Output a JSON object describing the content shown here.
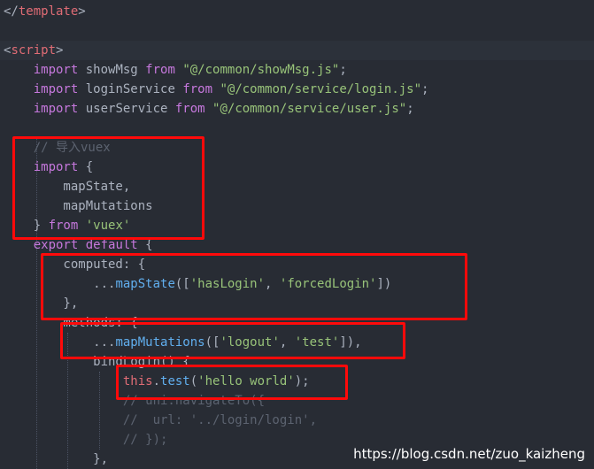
{
  "code_lines": [
    {
      "tokens": [
        {
          "t": "</",
          "c": "plain"
        },
        {
          "t": "template",
          "c": "tag"
        },
        {
          "t": ">",
          "c": "plain"
        }
      ]
    },
    {
      "tokens": []
    },
    {
      "tokens": [
        {
          "t": "<",
          "c": "plain"
        },
        {
          "t": "script",
          "c": "tag"
        },
        {
          "t": ">",
          "c": "plain"
        }
      ]
    },
    {
      "tokens": [
        {
          "t": "    "
        },
        {
          "t": "import",
          "c": "kw"
        },
        {
          "t": " showMsg ",
          "c": "plain"
        },
        {
          "t": "from",
          "c": "kw"
        },
        {
          "t": " ",
          "c": "plain"
        },
        {
          "t": "\"@/common/showMsg.js\"",
          "c": "str"
        },
        {
          "t": ";",
          "c": "plain"
        }
      ]
    },
    {
      "tokens": [
        {
          "t": "    "
        },
        {
          "t": "import",
          "c": "kw"
        },
        {
          "t": " loginService ",
          "c": "plain"
        },
        {
          "t": "from",
          "c": "kw"
        },
        {
          "t": " ",
          "c": "plain"
        },
        {
          "t": "\"@/common/service/login.js\"",
          "c": "str"
        },
        {
          "t": ";",
          "c": "plain"
        }
      ]
    },
    {
      "tokens": [
        {
          "t": "    "
        },
        {
          "t": "import",
          "c": "kw"
        },
        {
          "t": " userService ",
          "c": "plain"
        },
        {
          "t": "from",
          "c": "kw"
        },
        {
          "t": " ",
          "c": "plain"
        },
        {
          "t": "\"@/common/service/user.js\"",
          "c": "str"
        },
        {
          "t": ";",
          "c": "plain"
        }
      ]
    },
    {
      "tokens": []
    },
    {
      "tokens": [
        {
          "t": "    "
        },
        {
          "t": "// 导入vuex",
          "c": "comment"
        }
      ]
    },
    {
      "tokens": [
        {
          "t": "    "
        },
        {
          "t": "import",
          "c": "kw"
        },
        {
          "t": " {",
          "c": "plain"
        }
      ]
    },
    {
      "tokens": [
        {
          "t": "        mapState,",
          "c": "plain"
        }
      ]
    },
    {
      "tokens": [
        {
          "t": "        mapMutations",
          "c": "plain"
        }
      ]
    },
    {
      "tokens": [
        {
          "t": "    } ",
          "c": "plain"
        },
        {
          "t": "from",
          "c": "kw"
        },
        {
          "t": " ",
          "c": "plain"
        },
        {
          "t": "'vuex'",
          "c": "str"
        }
      ]
    },
    {
      "tokens": [
        {
          "t": "    "
        },
        {
          "t": "export",
          "c": "kw"
        },
        {
          "t": " ",
          "c": "plain"
        },
        {
          "t": "default",
          "c": "kw"
        },
        {
          "t": " {",
          "c": "plain"
        }
      ]
    },
    {
      "tokens": [
        {
          "t": "        computed: {",
          "c": "plain"
        }
      ]
    },
    {
      "tokens": [
        {
          "t": "            ...",
          "c": "plain"
        },
        {
          "t": "mapState",
          "c": "fn"
        },
        {
          "t": "([",
          "c": "plain"
        },
        {
          "t": "'hasLogin'",
          "c": "str"
        },
        {
          "t": ", ",
          "c": "plain"
        },
        {
          "t": "'forcedLogin'",
          "c": "str"
        },
        {
          "t": "])",
          "c": "plain"
        }
      ]
    },
    {
      "tokens": [
        {
          "t": "        },",
          "c": "plain"
        }
      ]
    },
    {
      "tokens": [
        {
          "t": "        methods: {",
          "c": "plain"
        }
      ]
    },
    {
      "tokens": [
        {
          "t": "            ...",
          "c": "plain"
        },
        {
          "t": "mapMutations",
          "c": "fn"
        },
        {
          "t": "([",
          "c": "plain"
        },
        {
          "t": "'logout'",
          "c": "str"
        },
        {
          "t": ", ",
          "c": "plain"
        },
        {
          "t": "'test'",
          "c": "str"
        },
        {
          "t": "]),",
          "c": "plain"
        }
      ]
    },
    {
      "tokens": [
        {
          "t": "            bindLogin() {",
          "c": "plain"
        }
      ]
    },
    {
      "tokens": [
        {
          "t": "                "
        },
        {
          "t": "this",
          "c": "this"
        },
        {
          "t": ".",
          "c": "plain"
        },
        {
          "t": "test",
          "c": "fn"
        },
        {
          "t": "(",
          "c": "plain"
        },
        {
          "t": "'hello world'",
          "c": "str"
        },
        {
          "t": ");",
          "c": "plain"
        }
      ]
    },
    {
      "tokens": [
        {
          "t": "                "
        },
        {
          "t": "// uni.navigateTo({",
          "c": "comment"
        }
      ]
    },
    {
      "tokens": [
        {
          "t": "                "
        },
        {
          "t": "//  url: '../login/login',",
          "c": "comment"
        }
      ]
    },
    {
      "tokens": [
        {
          "t": "                "
        },
        {
          "t": "// });",
          "c": "comment"
        }
      ]
    },
    {
      "tokens": [
        {
          "t": "            },",
          "c": "plain"
        }
      ]
    }
  ],
  "current_line_index": 2,
  "highlight_color": "#ff0a0a",
  "watermark": "https://blog.csdn.net/zuo_kaizheng"
}
